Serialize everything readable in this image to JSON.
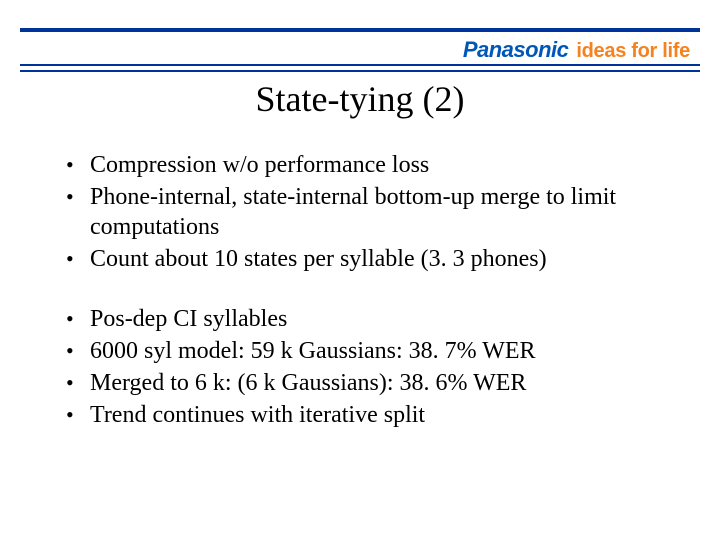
{
  "header": {
    "brand": "Panasonic",
    "tagline": "ideas for life"
  },
  "title": "State-tying (2)",
  "group1": [
    "Compression w/o performance loss",
    "Phone-internal, state-internal bottom-up merge to limit computations",
    "Count about 10 states per syllable (3. 3 phones)"
  ],
  "group2": [
    "Pos-dep CI syllables",
    "6000 syl model: 59 k Gaussians:   38. 7% WER",
    "Merged to 6 k: (6 k Gaussians):    38. 6% WER",
    "Trend continues with iterative split"
  ]
}
